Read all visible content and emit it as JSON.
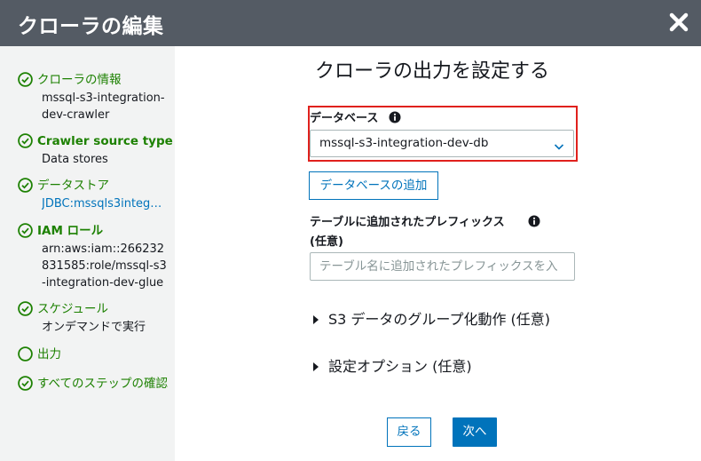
{
  "dialog": {
    "title": "クローラの編集"
  },
  "sidebar": {
    "steps": [
      {
        "label": "クローラの情報",
        "value": "mssql-s3-integration-dev-crawler",
        "status": "done"
      },
      {
        "label": "Crawler source type",
        "value": "Data stores",
        "status": "done"
      },
      {
        "label": "データストア",
        "value": "JDBC:mssqls3integ…",
        "status": "done"
      },
      {
        "label": "IAM ロール",
        "value": "arn:aws:iam::266232831585:role/mssql-s3-integration-dev-glue",
        "status": "done"
      },
      {
        "label": "スケジュール",
        "value": "オンデマンドで実行",
        "status": "done"
      },
      {
        "label": "出力",
        "value": "",
        "status": "current"
      },
      {
        "label": "すべてのステップの確認",
        "value": "",
        "status": "done"
      }
    ]
  },
  "main": {
    "heading": "クローラの出力を設定する",
    "database": {
      "label": "データベース",
      "selected": "mssql-s3-integration-dev-db",
      "add_button": "データベースの追加"
    },
    "prefix": {
      "label": "テーブルに追加されたプレフィックス",
      "optional": "(任意)",
      "placeholder": "テーブル名に追加されたプレフィックスを入"
    },
    "expanders": [
      {
        "label": "S3 データのグループ化動作 (任意)"
      },
      {
        "label": "設定オプション (任意)"
      }
    ],
    "buttons": {
      "back": "戻る",
      "next": "次へ"
    }
  },
  "colors": {
    "header_bg": "#545b64",
    "sidebar_bg": "#f2f3f3",
    "step_green": "#1d8102",
    "link_blue": "#0073bb",
    "highlight_red": "#e0211d"
  },
  "icons": {
    "close": "close-icon",
    "step_done": "check-circle-icon",
    "step_current": "empty-circle-icon",
    "info": "info-icon",
    "select": "chevron-down-icon",
    "expander": "caret-right-icon"
  }
}
